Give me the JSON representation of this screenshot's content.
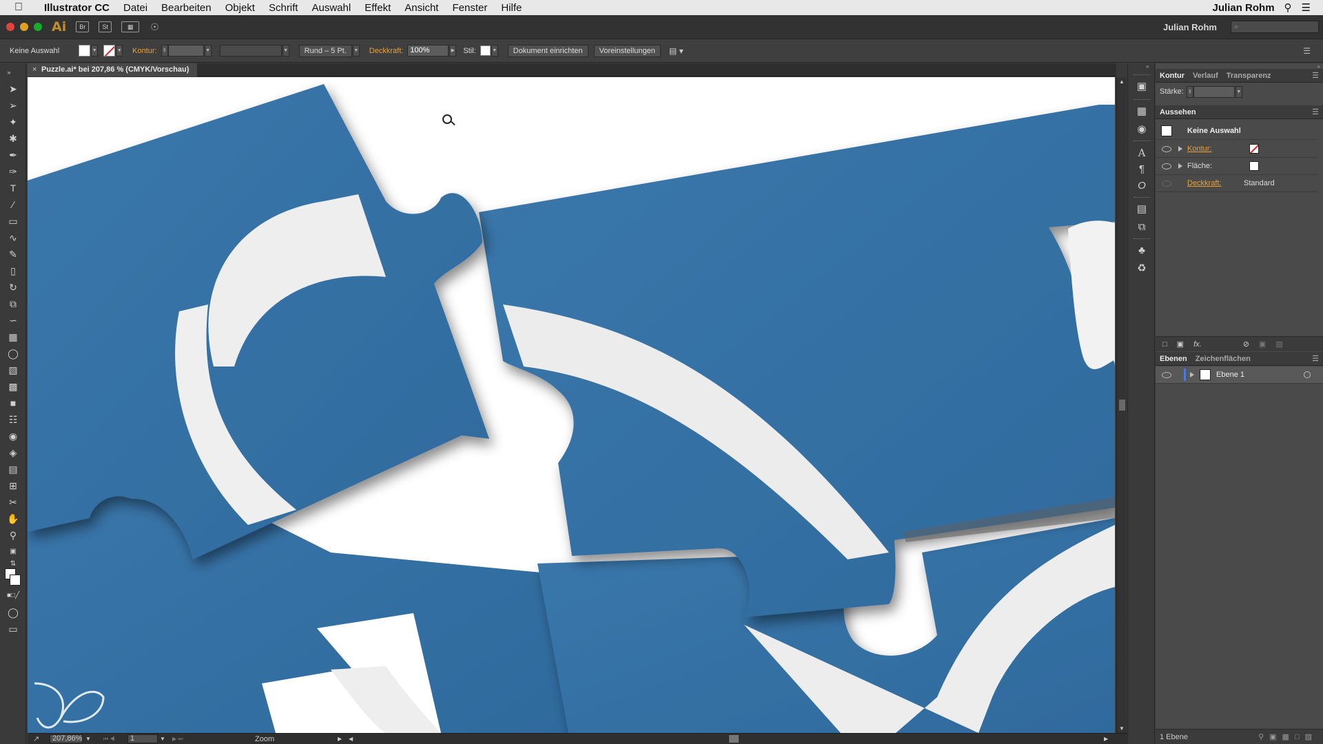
{
  "menubar": {
    "app": "Illustrator CC",
    "items": [
      "Datei",
      "Bearbeiten",
      "Objekt",
      "Schrift",
      "Auswahl",
      "Effekt",
      "Ansicht",
      "Fenster",
      "Hilfe"
    ],
    "user": "Julian Rohm",
    "icons": [
      "search-icon",
      "list-icon"
    ]
  },
  "appbar": {
    "logo": "Ai",
    "buttons": [
      "Br",
      "St"
    ],
    "user": "Julian Rohm",
    "search_placeholder": "⌕"
  },
  "controlbar": {
    "selection": "Keine Auswahl",
    "stroke_label": "Kontur:",
    "brush": "Rund – 5 Pt.",
    "opacity_label": "Deckkraft:",
    "opacity_value": "100%",
    "style_label": "Stil:",
    "doc_setup": "Dokument einrichten",
    "preferences": "Voreinstellungen"
  },
  "document": {
    "tab_title": "Puzzle.ai* bei 207,86 % (CMYK/Vorschau)",
    "close": "×"
  },
  "statusbar": {
    "zoom": "207,86%",
    "page": "1",
    "mode": "Zoom"
  },
  "panels": {
    "stroke": {
      "tabs": [
        "Kontur",
        "Verlauf",
        "Transparenz"
      ],
      "weight_label": "Stärke:"
    },
    "appearance": {
      "title": "Aussehen",
      "header": "Keine Auswahl",
      "rows": [
        {
          "label": "Kontur:",
          "color": "#e8a23a"
        },
        {
          "label": "Fläche:",
          "color": "#dddddd"
        },
        {
          "label": "Deckkraft:",
          "value": "Standard",
          "color": "#e8a23a"
        }
      ],
      "fx": "fx."
    },
    "layers": {
      "tabs": [
        "Ebenen",
        "Zeichenflächen"
      ],
      "layer_name": "Ebene 1",
      "count": "1 Ebene"
    }
  },
  "colors": {
    "puzzle_blue": "#3b7aae",
    "puzzle_white": "#f0f0f0",
    "accent_orange": "#e8a23a"
  }
}
